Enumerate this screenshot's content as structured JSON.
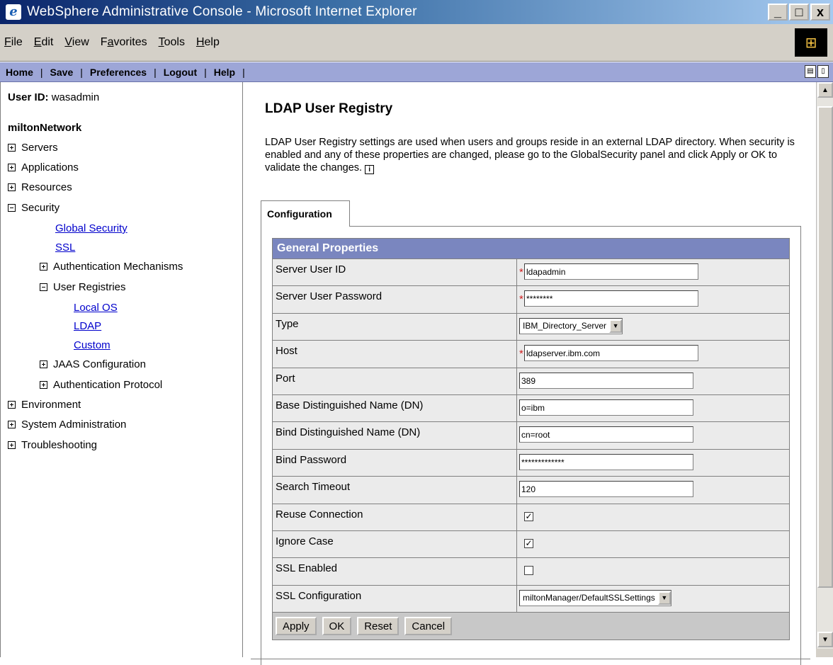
{
  "window": {
    "title": "WebSphere Administrative Console - Microsoft Internet Explorer",
    "controls": [
      "_",
      "□",
      "x"
    ]
  },
  "menubar": {
    "items": [
      {
        "acc": "F",
        "rest": "ile"
      },
      {
        "acc": "E",
        "rest": "dit"
      },
      {
        "acc": "V",
        "rest": "iew"
      },
      {
        "pre": "F",
        "acc": "a",
        "rest": "vorites"
      },
      {
        "acc": "T",
        "rest": "ools"
      },
      {
        "acc": "H",
        "rest": "elp"
      }
    ]
  },
  "navbar": {
    "items": [
      "Home",
      "Save",
      "Preferences",
      "Logout",
      "Help"
    ],
    "separator": "|"
  },
  "sidebar": {
    "user_label": "User ID:",
    "user_value": "wasadmin",
    "cell": "miltonNetwork",
    "tree": [
      {
        "label": "Servers",
        "toggle": "plus"
      },
      {
        "label": "Applications",
        "toggle": "plus"
      },
      {
        "label": "Resources",
        "toggle": "plus"
      },
      {
        "label": "Security",
        "toggle": "minus"
      },
      {
        "label": "Global Security",
        "link": true
      },
      {
        "label": "SSL",
        "link": true
      },
      {
        "label": "Authentication Mechanisms",
        "toggle": "plus"
      },
      {
        "label": "User Registries",
        "toggle": "minus"
      },
      {
        "label": "Local OS",
        "link": true
      },
      {
        "label": "LDAP",
        "link": true
      },
      {
        "label": "Custom",
        "link": true
      },
      {
        "label": "JAAS Configuration",
        "toggle": "plus"
      },
      {
        "label": "Authentication Protocol",
        "toggle": "plus"
      },
      {
        "label": "Environment",
        "toggle": "plus"
      },
      {
        "label": "System Administration",
        "toggle": "plus"
      },
      {
        "label": "Troubleshooting",
        "toggle": "plus"
      }
    ]
  },
  "main": {
    "title": "LDAP User Registry",
    "description": "LDAP User Registry settings are used when users and groups reside in an external LDAP directory. When security is enabled and any of these properties are changed, please go to the GlobalSecurity panel and click Apply or OK to validate the changes.",
    "info_glyph": "i",
    "tab": "Configuration",
    "section": "General Properties",
    "required_glyph": "*",
    "fields": {
      "server_user_id": {
        "label": "Server User ID",
        "value": "ldapadmin"
      },
      "server_user_password": {
        "label": "Server User Password",
        "value": "********"
      },
      "type": {
        "label": "Type",
        "value": "IBM_Directory_Server"
      },
      "host": {
        "label": "Host",
        "value": "ldapserver.ibm.com"
      },
      "port": {
        "label": "Port",
        "value": "389"
      },
      "base_dn": {
        "label": "Base Distinguished Name (DN)",
        "value": "o=ibm"
      },
      "bind_dn": {
        "label": "Bind Distinguished Name (DN)",
        "value": "cn=root"
      },
      "bind_password": {
        "label": "Bind Password",
        "value": "*************"
      },
      "search_timeout": {
        "label": "Search Timeout",
        "value": "120"
      },
      "reuse_connection": {
        "label": "Reuse Connection",
        "checked": true
      },
      "ignore_case": {
        "label": "Ignore Case",
        "checked": true
      },
      "ssl_enabled": {
        "label": "SSL Enabled",
        "checked": false
      },
      "ssl_configuration": {
        "label": "SSL Configuration",
        "value": "miltonManager/DefaultSSLSettings"
      }
    },
    "buttons": {
      "apply": "Apply",
      "ok": "OK",
      "reset": "Reset",
      "cancel": "Cancel"
    }
  },
  "colors": {
    "navbar": "#9da6d7",
    "section_header": "#7a86bf",
    "link": "#0000cc",
    "required": "#d02020"
  }
}
